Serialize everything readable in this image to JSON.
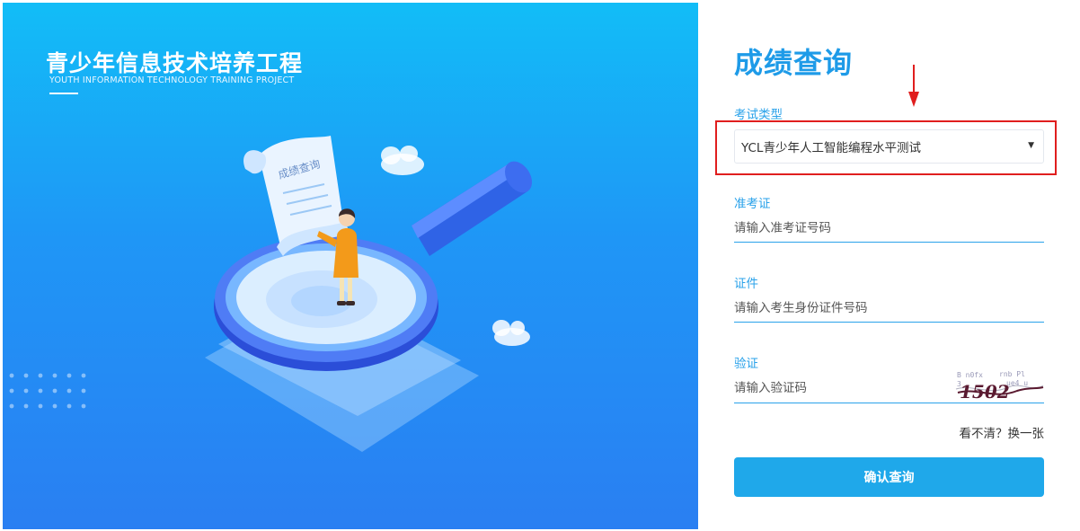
{
  "hero": {
    "title": "青少年信息技术培养工程",
    "subtitle": "YOUTH INFORMATION TECHNOLOGY TRAINING PROJECT",
    "illustration_paper_text": "成绩查询",
    "background_colors": [
      "#12bdf7",
      "#2a7ff2"
    ]
  },
  "form": {
    "title": "成绩查询",
    "exam_type": {
      "label": "考试类型",
      "selected": "YCL青少年人工智能编程水平测试",
      "caret": "▼"
    },
    "ticket": {
      "label": "准考证",
      "placeholder": "请输入准考证号码",
      "value": ""
    },
    "id_card": {
      "label": "证件",
      "placeholder": "请输入考生身份证件号码",
      "value": ""
    },
    "captcha": {
      "label": "验证",
      "placeholder": "请输入验证码",
      "value": "",
      "image_text": "1502"
    },
    "refresh_text": "看不清？换一张",
    "submit_label": "确认查询"
  },
  "colors": {
    "accent": "#1e9be8",
    "button": "#1fa8ea",
    "highlight": "#e01e1e"
  }
}
